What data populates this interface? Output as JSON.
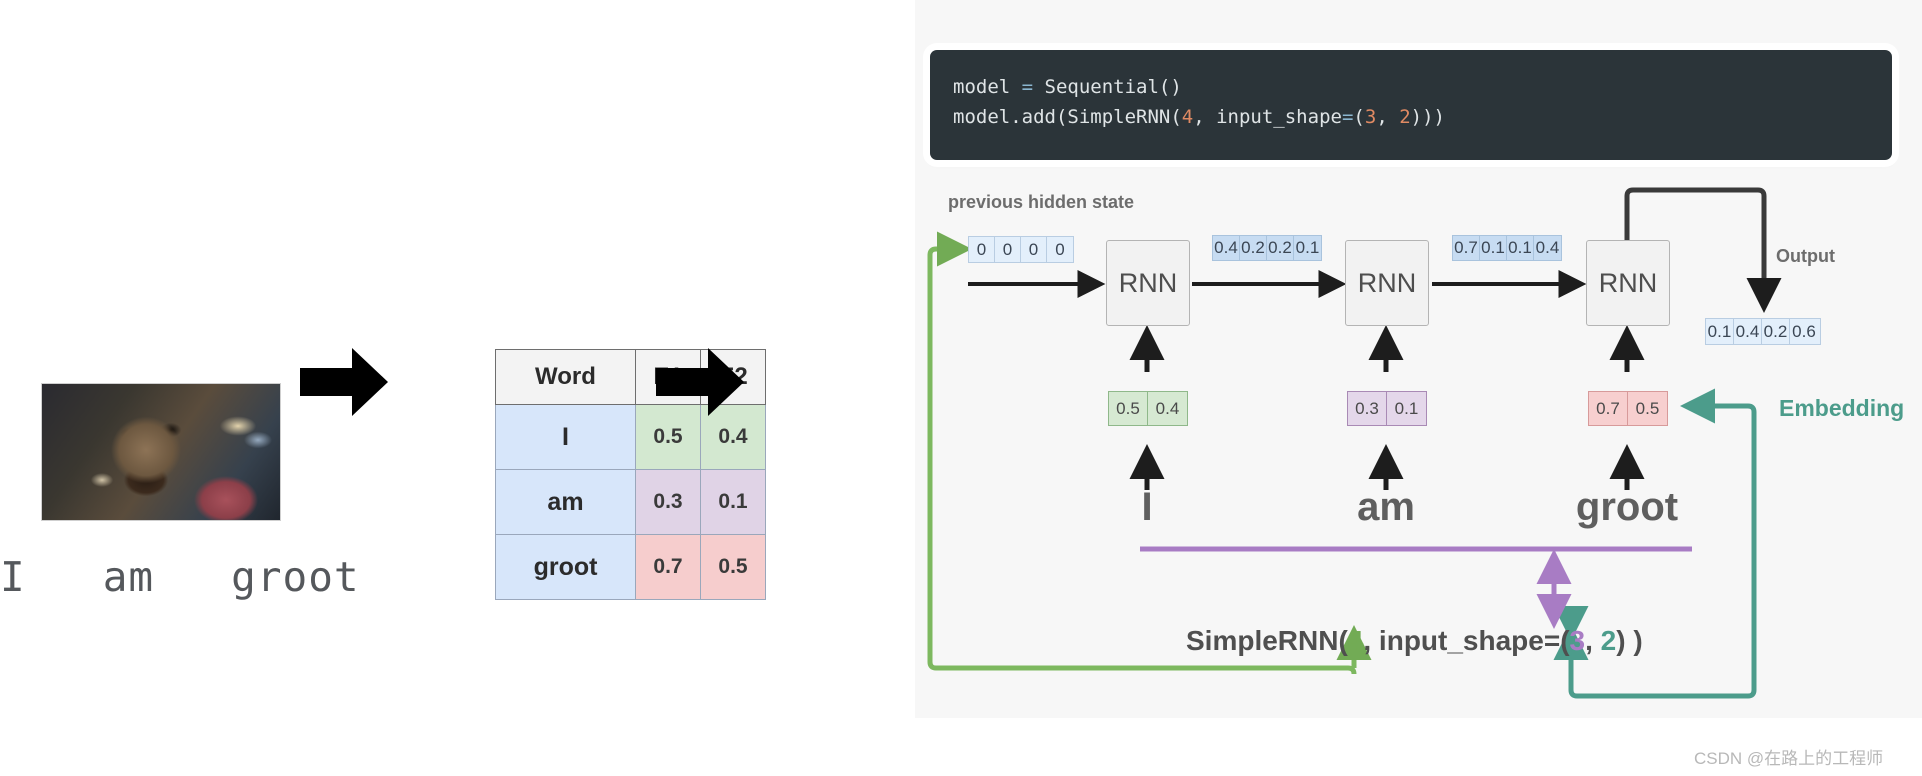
{
  "left": {
    "image_alt": "groot-photo",
    "sentence": "I   am   groot",
    "arrow_icon": "right-arrow-icon"
  },
  "table": {
    "headers": [
      "Word",
      "E1",
      "E2"
    ],
    "rows": [
      {
        "word": "I",
        "e1": "0.5",
        "e2": "0.4",
        "tint": "green"
      },
      {
        "word": "am",
        "e1": "0.3",
        "e2": "0.1",
        "tint": "purple"
      },
      {
        "word": "groot",
        "e1": "0.7",
        "e2": "0.5",
        "tint": "red"
      }
    ]
  },
  "code": {
    "line1_a": "model ",
    "line1_op": "=",
    "line1_b": " Sequential()",
    "line2_a": "model.add(SimpleRNN(",
    "line2_n1": "4",
    "line2_b": ", input_shape",
    "line2_op": "=",
    "line2_c": "(",
    "line2_n2": "3",
    "line2_d": ", ",
    "line2_n3": "2",
    "line2_e": ")))"
  },
  "diagram": {
    "prev_hidden_label": "previous hidden state",
    "output_label": "Output",
    "embedding_label": "Embedding",
    "rnn_label": "RNN",
    "initial_hidden_state": [
      "0",
      "0",
      "0",
      "0"
    ],
    "hidden_state_1": [
      "0.4",
      "0.2",
      "0.2",
      "0.1"
    ],
    "hidden_state_2": [
      "0.7",
      "0.1",
      "0.1",
      "0.4"
    ],
    "output_vector": [
      "0.1",
      "0.4",
      "0.2",
      "0.6"
    ],
    "steps": [
      {
        "word": "I",
        "embedding": [
          "0.5",
          "0.4"
        ],
        "tint": "green"
      },
      {
        "word": "am",
        "embedding": [
          "0.3",
          "0.1"
        ],
        "tint": "purple"
      },
      {
        "word": "groot",
        "embedding": [
          "0.7",
          "0.5"
        ],
        "tint": "red"
      }
    ]
  },
  "formula": {
    "a": "SimpleRNN(",
    "units": "4",
    "b": ", input_shape=(",
    "timesteps": "3",
    "c": ", ",
    "features": "2",
    "d": ") )"
  },
  "watermark": "CSDN @在路上的工程师",
  "colors": {
    "green": "#72ab55",
    "purple": "#a87cc4",
    "teal": "#4c9c8b",
    "code_bg": "#2b3439",
    "panel_bg": "#f7f7f7"
  }
}
